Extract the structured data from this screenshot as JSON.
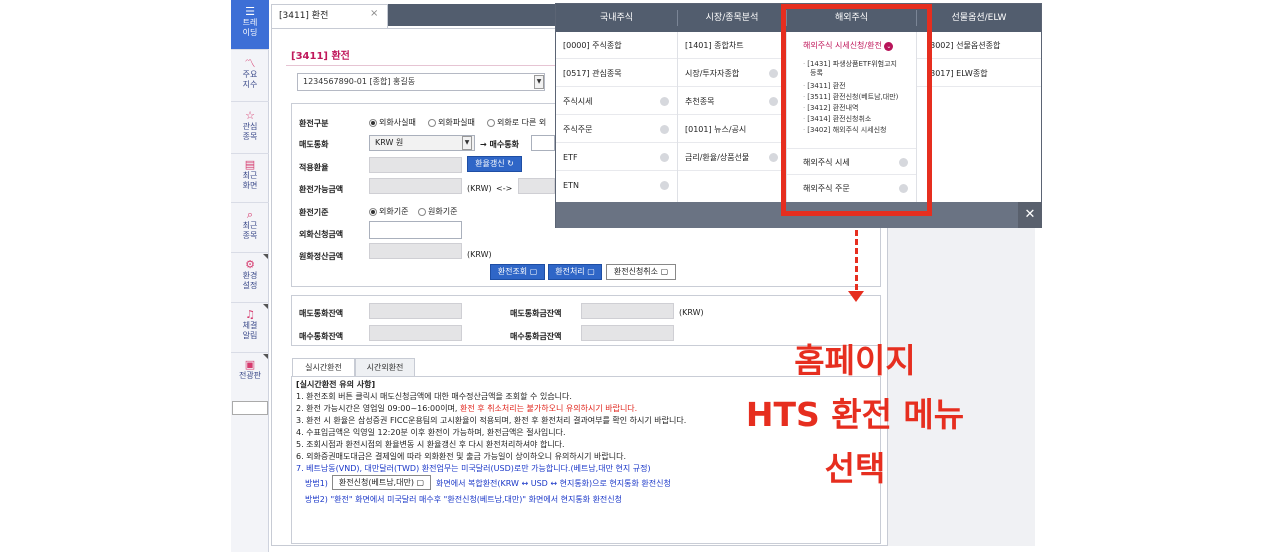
{
  "sidebar": {
    "items": [
      {
        "icon": "list-icon",
        "label": "트레이딩"
      },
      {
        "icon": "chart-line-icon",
        "label": "주요지수"
      },
      {
        "icon": "star-icon",
        "label": "관심종목"
      },
      {
        "icon": "calendar-icon",
        "label": "최근화면"
      },
      {
        "icon": "search-icon",
        "label": "최근종목"
      },
      {
        "icon": "gear-icon",
        "label": "환경설정"
      },
      {
        "icon": "bell-icon",
        "label": "체결알림"
      },
      {
        "icon": "board-icon",
        "label": "전광판"
      }
    ]
  },
  "tab": {
    "label": "[3411] 환전",
    "close": "×"
  },
  "page": {
    "title": "[3411] 환전",
    "account": "1234567890-01 [종합] 홍길동"
  },
  "form": {
    "exchange_type_label": "환전구분",
    "radio1": "외화사실때",
    "radio2": "외화파실때",
    "radio3": "외화로 다른 외",
    "sell_currency_label": "매도통화",
    "sell_currency_value": "KRW 원",
    "buy_currency_label": "→ 매수통화",
    "rate_label": "적용환율",
    "rate_refresh_btn": "환율갱신",
    "available_label": "환전가능금액",
    "available_unit": "(KRW)",
    "arrows": "<->",
    "basis_label": "환전기준",
    "basis_radio1": "외화기준",
    "basis_radio2": "원화기준",
    "fx_request_label": "외화신청금액",
    "krw_settle_label": "원화정산금액",
    "krw_settle_unit": "(KRW)",
    "btn_query": "환전조회",
    "btn_process": "환전처리",
    "btn_cancel": "환전신청취소"
  },
  "balance": {
    "sell_balance_label": "매도통화잔액",
    "sell_avail_label": "매도통화금잔액",
    "unit": "(KRW)",
    "buy_balance_label": "매수통화잔액",
    "buy_avail_label": "매수통화금잔액"
  },
  "subtabs": [
    "실시간환전",
    "시간외환전"
  ],
  "notes": {
    "heading": "[실시간환전 유의 사항]",
    "l1": "1. 환전조회 버튼 클릭시 매도신청금액에 대한 매수정산금액을 조회할 수 있습니다.",
    "l2a": "2. 환전 가능시간은 영업일 09:00~16:00이며, ",
    "l2b": "환전 후 취소처리는 불가하오니 유의하시기 바랍니다.",
    "l3": "3. 환전 시 환율은 삼성증권 FICC운용팀의 고시환율이 적용되며, 환전 후 환전처리 결과여부를 확인 하시기 바랍니다.",
    "l4": "4. 수표입금액은 익영일 12:20분 이후 환전이 가능하며, 환전금액은 절사입니다.",
    "l5": "5. 조회시점과 환전시점의 환율변동 시 환율갱신 후 다시 환전처리하셔야 합니다.",
    "l6": "6. 외화증권매도대금은 결제일에 따라 외화환전 및 출금 가능일이 상이하오니 유의하시기 바랍니다.",
    "l7": "7. 베트남동(VND), 대만달러(TWD) 환전업무는 미국달러(USD)로만 가능합니다.(베트남,대만 현지 규정)",
    "m1_prefix": "방법1)",
    "m1_btn": "환전신청(베트남,대만)",
    "m1_text": "화면에서 복합환전(KRW ↔ USD ↔ 현지통화)으로 현지통화 환전신청",
    "m2": "방법2) \"환전\" 화면에서 미국달러 매수후 \"환전신청(베트남,대만)\" 화면에서 현지통화 환전신청"
  },
  "menu": {
    "headers": [
      "국내주식",
      "시장/종목분석",
      "해외주식",
      "선물옵션/ELW"
    ],
    "col1": [
      "[0000] 주식종합",
      "[0517] 관심종목",
      "주식시세",
      "주식주문",
      "ETF",
      "ETN"
    ],
    "col2": [
      "[1401] 종합차트",
      "시장/투자자종합",
      "추천종목",
      "[0101] 뉴스/공시",
      "금리/환율/상품선물"
    ],
    "col3_head": "해외주식 시세신청/환전",
    "col3_sub": [
      "[1431] 파생상품ETF위험고지",
      "등록",
      "[3411] 환전",
      "[3511] 환전신청(베트남,대만)",
      "[3412] 환전내역",
      "[3414] 환전신청취소",
      "[3402] 해외주식 시세신청"
    ],
    "col3_items": [
      "해외주식 시세",
      "해외주식 주문"
    ],
    "col4": [
      "[3002] 선물옵션종합",
      "[3017] ELW종합"
    ],
    "close": "✕"
  },
  "annotation": {
    "line1": "홈페이지",
    "line2": "HTS 환전 메뉴",
    "line3": "선택"
  },
  "colors": {
    "highlight": "#e62e1f",
    "accent": "#2f66c7",
    "title": "#c0185b"
  }
}
